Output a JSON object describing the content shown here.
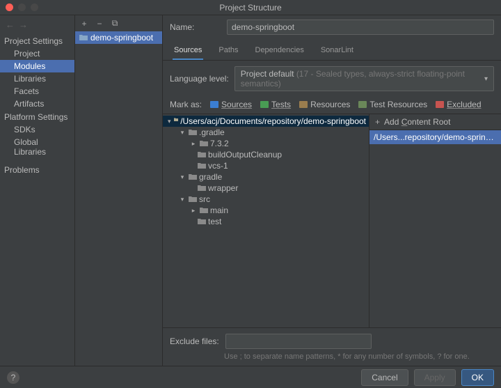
{
  "title": "Project Structure",
  "nav": {
    "project_settings": "Project Settings",
    "project": "Project",
    "modules": "Modules",
    "libraries": "Libraries",
    "facets": "Facets",
    "artifacts": "Artifacts",
    "platform_settings": "Platform Settings",
    "sdks": "SDKs",
    "global_libraries": "Global Libraries",
    "problems": "Problems"
  },
  "module_list": {
    "item0": "demo-springboot"
  },
  "form": {
    "name_label": "Name:",
    "name_value": "demo-springboot",
    "lang_label": "Language level:",
    "lang_value": "Project default",
    "lang_hint": "(17 - Sealed types, always-strict floating-point semantics)"
  },
  "tabs": {
    "sources": "Sources",
    "paths": "Paths",
    "dependencies": "Dependencies",
    "sonarlint": "SonarLint"
  },
  "marks": {
    "label": "Mark as:",
    "sources": "Sources",
    "tests": "Tests",
    "resources": "Resources",
    "test_resources": "Test Resources",
    "excluded": "Excluded"
  },
  "tree": {
    "root": "/Users/acj/Documents/repository/demo-springboot",
    "n_gradle": ".gradle",
    "n_732": "7.3.2",
    "n_boc": "buildOutputCleanup",
    "n_vcs": "vcs-1",
    "n_gradle2": "gradle",
    "n_wrapper": "wrapper",
    "n_src": "src",
    "n_main": "main",
    "n_test": "test"
  },
  "roots": {
    "add": "Add Content Root",
    "path": "/Users...repository/demo-springboot"
  },
  "exclude": {
    "label": "Exclude files:",
    "hint": "Use ; to separate name patterns, * for any number of symbols, ? for one."
  },
  "buttons": {
    "cancel": "Cancel",
    "apply": "Apply",
    "ok": "OK"
  },
  "icons": {
    "plus": "+",
    "minus": "−",
    "copy": "⧉",
    "back": "←",
    "fwd": "→",
    "chev_down": "▾",
    "chev_right": "▸",
    "help": "?"
  }
}
